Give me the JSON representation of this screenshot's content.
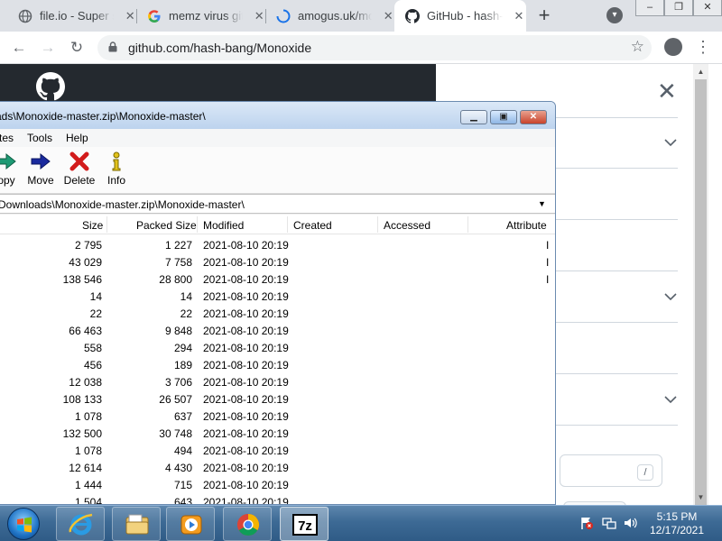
{
  "browser": {
    "tabs": [
      {
        "title": "file.io - Super simple file sharing",
        "icon": "globe-icon",
        "active": false
      },
      {
        "title": "memz virus github",
        "icon": "google-icon",
        "active": false
      },
      {
        "title": "amogus.uk/monoxide",
        "icon": "loading-icon",
        "active": false
      },
      {
        "title": "GitHub - hash-bang/Monoxide",
        "icon": "github-icon",
        "active": true
      }
    ],
    "tab_close_glyph": "✕",
    "new_tab_glyph": "+",
    "url": "github.com/hash-bang/Monoxide"
  },
  "github": {
    "close_glyph": "✕",
    "search_shortcut": "/"
  },
  "sevenzip": {
    "title": "ads\\Monoxide-master.zip\\Monoxide-master\\",
    "menu": [
      "tes",
      "Tools",
      "Help"
    ],
    "toolbar": [
      {
        "label": "opy",
        "icon": "copy-arrow-icon"
      },
      {
        "label": "Move",
        "icon": "move-arrow-icon"
      },
      {
        "label": "Delete",
        "icon": "delete-x-icon"
      },
      {
        "label": "Info",
        "icon": "info-icon"
      }
    ],
    "path": "Downloads\\Monoxide-master.zip\\Monoxide-master\\",
    "columns": {
      "size": "Size",
      "packed": "Packed Size",
      "modified": "Modified",
      "created": "Created",
      "accessed": "Accessed",
      "attributes": "Attribute"
    },
    "rows": [
      {
        "size": "2 795",
        "packed": "1 227",
        "modified": "2021-08-10 20:19",
        "attr": "I"
      },
      {
        "size": "43 029",
        "packed": "7 758",
        "modified": "2021-08-10 20:19",
        "attr": "I"
      },
      {
        "size": "138 546",
        "packed": "28 800",
        "modified": "2021-08-10 20:19",
        "attr": "I"
      },
      {
        "size": "14",
        "packed": "14",
        "modified": "2021-08-10 20:19",
        "attr": ""
      },
      {
        "size": "22",
        "packed": "22",
        "modified": "2021-08-10 20:19",
        "attr": ""
      },
      {
        "size": "66 463",
        "packed": "9 848",
        "modified": "2021-08-10 20:19",
        "attr": ""
      },
      {
        "size": "558",
        "packed": "294",
        "modified": "2021-08-10 20:19",
        "attr": ""
      },
      {
        "size": "456",
        "packed": "189",
        "modified": "2021-08-10 20:19",
        "attr": ""
      },
      {
        "size": "12 038",
        "packed": "3 706",
        "modified": "2021-08-10 20:19",
        "attr": ""
      },
      {
        "size": "108 133",
        "packed": "26 507",
        "modified": "2021-08-10 20:19",
        "attr": ""
      },
      {
        "size": "1 078",
        "packed": "637",
        "modified": "2021-08-10 20:19",
        "attr": ""
      },
      {
        "size": "132 500",
        "packed": "30 748",
        "modified": "2021-08-10 20:19",
        "attr": ""
      },
      {
        "size": "1 078",
        "packed": "494",
        "modified": "2021-08-10 20:19",
        "attr": ""
      },
      {
        "size": "12 614",
        "packed": "4 430",
        "modified": "2021-08-10 20:19",
        "attr": ""
      },
      {
        "size": "1 444",
        "packed": "715",
        "modified": "2021-08-10 20:19",
        "attr": ""
      },
      {
        "size": "1 504",
        "packed": "643",
        "modified": "2021-08-10 20:19",
        "attr": ""
      }
    ]
  },
  "taskbar": {
    "apps": [
      {
        "name": "internet-explorer-icon",
        "label": "Internet Explorer"
      },
      {
        "name": "windows-explorer-icon",
        "label": "Windows Explorer"
      },
      {
        "name": "media-player-icon",
        "label": "Windows Media Player"
      },
      {
        "name": "chrome-icon",
        "label": "Google Chrome"
      },
      {
        "name": "7zip-icon",
        "label": "7-Zip File Manager"
      }
    ],
    "sevenzip_icon_text": "7z",
    "time": "5:15 PM",
    "date": "12/17/2021"
  }
}
